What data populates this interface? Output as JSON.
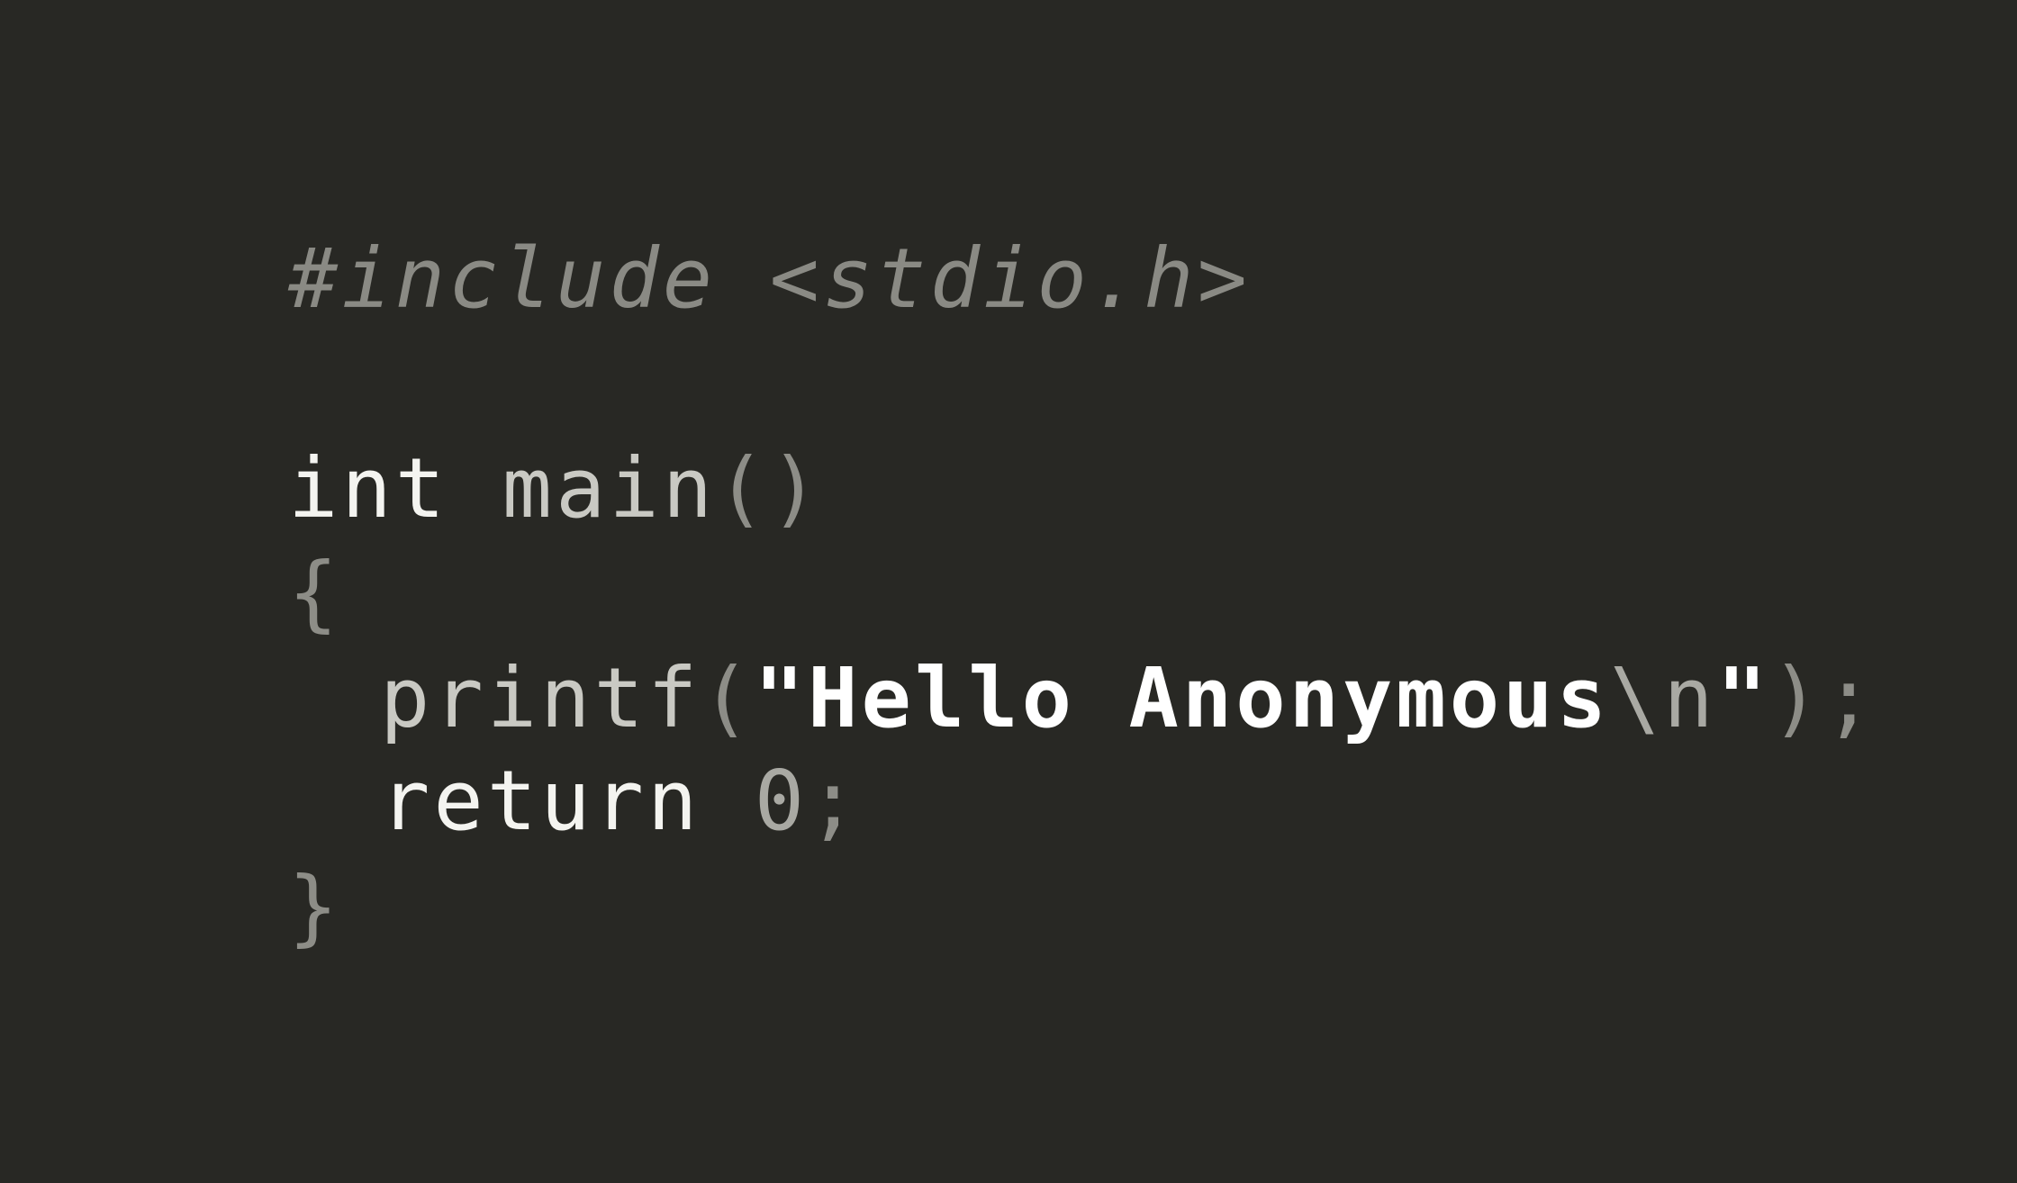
{
  "code": {
    "line1": {
      "directive": "#include",
      "space": " ",
      "header": "<stdio.h>"
    },
    "line3": {
      "type": "int",
      "space": " ",
      "name": "main",
      "open_paren": "(",
      "close_paren": ")"
    },
    "line4": {
      "open_brace": "{"
    },
    "line5": {
      "func": "printf",
      "open_paren": "(",
      "string_open": "\"Hello Anonymous",
      "escape": "\\n",
      "string_close": "\"",
      "close_paren": ")",
      "semicolon": ";"
    },
    "line6": {
      "keyword": "return",
      "space": " ",
      "value": "0",
      "semicolon": ";"
    },
    "line7": {
      "close_brace": "}"
    }
  },
  "colors": {
    "background": "#282824",
    "comment": "#8a8a84",
    "keyword": "#f4f4f0",
    "function": "#c9c9c3",
    "punctuation": "#8d8d87",
    "string": "#ffffff"
  }
}
